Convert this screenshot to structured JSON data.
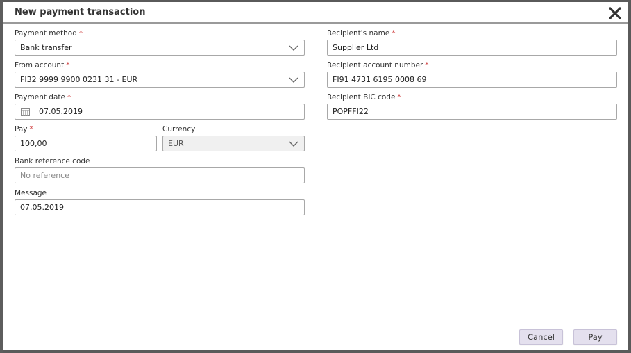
{
  "dialog": {
    "title": "New payment transaction",
    "close_icon": "close-icon"
  },
  "form": {
    "required_marker": "*",
    "payment_method": {
      "label": "Payment method",
      "value": "Bank transfer"
    },
    "from_account": {
      "label": "From account",
      "value": "FI32 9999 9900 0231 31 - EUR"
    },
    "payment_date": {
      "label": "Payment date",
      "value": "07.05.2019",
      "icon": "calendar-icon"
    },
    "pay": {
      "label": "Pay",
      "value": "100,00"
    },
    "currency": {
      "label": "Currency",
      "value": "EUR"
    },
    "bank_reference": {
      "label": "Bank reference code",
      "placeholder": "No reference"
    },
    "message": {
      "label": "Message",
      "value": "07.05.2019"
    },
    "recipient_name": {
      "label": "Recipient's name",
      "value": "Supplier Ltd"
    },
    "recipient_account": {
      "label": "Recipient account number",
      "value": "FI91 4731 6195 0008 69"
    },
    "recipient_bic": {
      "label": "Recipient BIC code",
      "value": "POPFFI22"
    }
  },
  "buttons": {
    "cancel": "Cancel",
    "pay": "Pay"
  },
  "colors": {
    "required": "#d04040",
    "button_bg": "#e4e0ee",
    "overlay": "#5a5a5a"
  }
}
